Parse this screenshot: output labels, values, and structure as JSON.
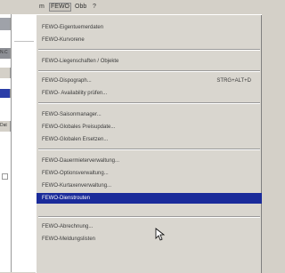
{
  "menubar": {
    "items": [
      {
        "label": "m"
      },
      {
        "label": "FEWO"
      },
      {
        "label": "Obb"
      },
      {
        "label": "?"
      }
    ]
  },
  "left_panel": {
    "labels": [
      "N.C",
      "Dat"
    ]
  },
  "menu": {
    "items": [
      {
        "label": "FEWO-Eigentuemerdaten",
        "shortcut": ""
      },
      {
        "label": "FEWO-Kurvorene",
        "shortcut": ""
      },
      {
        "label": "FEWO-Liegenschaften / Objekte",
        "shortcut": ""
      },
      {
        "label": "FEWO-Dispograph...",
        "shortcut": "STRG+ALT+D"
      },
      {
        "label": "FEWO- Availability prüfen...",
        "shortcut": ""
      },
      {
        "label": "FEWO-Saisonmanager...",
        "shortcut": ""
      },
      {
        "label": "FEWO-Globales Preisupdate...",
        "shortcut": ""
      },
      {
        "label": "FEWO-Globalen Ersetzen...",
        "shortcut": ""
      },
      {
        "label": "FEWO-Dauermieterverwaltung...",
        "shortcut": ""
      },
      {
        "label": "FEWO-Optionsverwaltung...",
        "shortcut": ""
      },
      {
        "label": "FEWO-Kurtaxenverwaltung...",
        "shortcut": ""
      },
      {
        "label": "FEWO-Dienstrouten",
        "shortcut": ""
      },
      {
        "label": "FEWO-Abrechnung...",
        "shortcut": ""
      },
      {
        "label": "FEWO-Meldungslisten",
        "shortcut": ""
      }
    ],
    "highlighted_index": 11
  },
  "colors": {
    "highlight": "#1a2b9a",
    "menu_bg": "#d9d6cf"
  }
}
